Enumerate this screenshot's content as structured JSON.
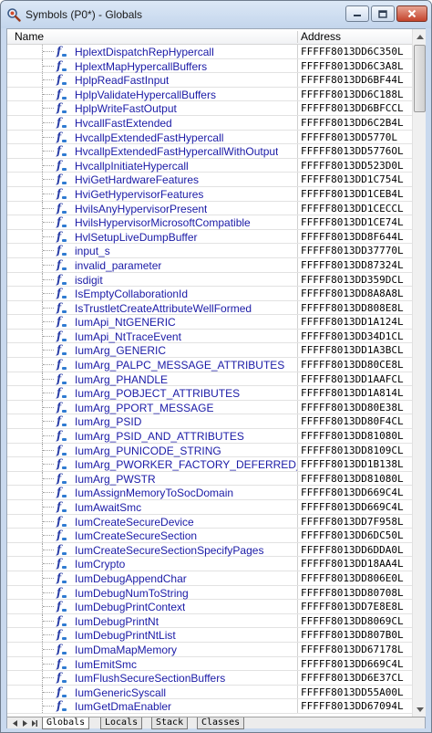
{
  "window": {
    "title": "Symbols (P0*) - Globals",
    "icon": "magnifier-icon"
  },
  "columns": {
    "name": "Name",
    "address": "Address"
  },
  "rows": [
    {
      "name": "HplextDispatchRepHypercall",
      "address": "FFFFF8013DD6C350L"
    },
    {
      "name": "HplextMapHypercallBuffers",
      "address": "FFFFF8013DD6C3A8L"
    },
    {
      "name": "HplpReadFastInput",
      "address": "FFFFF8013DD6BF44L"
    },
    {
      "name": "HplpValidateHypercallBuffers",
      "address": "FFFFF8013DD6C188L"
    },
    {
      "name": "HplpWriteFastOutput",
      "address": "FFFFF8013DD6BFCCL"
    },
    {
      "name": "HvcallFastExtended",
      "address": "FFFFF8013DD6C2B4L"
    },
    {
      "name": "HvcallpExtendedFastHypercall",
      "address": "FFFFF8013DD5770L"
    },
    {
      "name": "HvcallpExtendedFastHypercallWithOutput",
      "address": "FFFFF8013DD5776OL"
    },
    {
      "name": "HvcallpInitiateHypercall",
      "address": "FFFFF8013DD523D0L"
    },
    {
      "name": "HviGetHardwareFeatures",
      "address": "FFFFF8013DD1C754L"
    },
    {
      "name": "HviGetHypervisorFeatures",
      "address": "FFFFF8013DD1CEB4L"
    },
    {
      "name": "HvilsAnyHypervisorPresent",
      "address": "FFFFF8013DD1CECCL"
    },
    {
      "name": "HvilsHypervisorMicrosoftCompatible",
      "address": "FFFFF8013DD1CE74L"
    },
    {
      "name": "HvlSetupLiveDumpBuffer",
      "address": "FFFFF8013DD8F644L"
    },
    {
      "name": "input_s",
      "address": "FFFFF8013DD37770L"
    },
    {
      "name": "invalid_parameter",
      "address": "FFFFF8013DD87324L"
    },
    {
      "name": "isdigit",
      "address": "FFFFF8013DD359DCL"
    },
    {
      "name": "IsEmptyCollaborationId",
      "address": "FFFFF8013DD8A8A8L"
    },
    {
      "name": "IsTrustletCreateAttributeWellFormed",
      "address": "FFFFF8013DD808E8L"
    },
    {
      "name": "IumApi_NtGENERIC",
      "address": "FFFFF8013DD1A124L"
    },
    {
      "name": "IumApi_NtTraceEvent",
      "address": "FFFFF8013DD34D1CL"
    },
    {
      "name": "IumArg_GENERIC",
      "address": "FFFFF8013DD1A3BCL"
    },
    {
      "name": "IumArg_PALPC_MESSAGE_ATTRIBUTES",
      "address": "FFFFF8013DD80CE8L"
    },
    {
      "name": "IumArg_PHANDLE",
      "address": "FFFFF8013DD1AAFCL"
    },
    {
      "name": "IumArg_POBJECT_ATTRIBUTES",
      "address": "FFFFF8013DD1A814L"
    },
    {
      "name": "IumArg_PPORT_MESSAGE",
      "address": "FFFFF8013DD80E38L"
    },
    {
      "name": "IumArg_PSID",
      "address": "FFFFF8013DD80F4CL"
    },
    {
      "name": "IumArg_PSID_AND_ATTRIBUTES",
      "address": "FFFFF8013DD81080L"
    },
    {
      "name": "IumArg_PUNICODE_STRING",
      "address": "FFFFF8013DD8109CL"
    },
    {
      "name": "IumArg_PWORKER_FACTORY_DEFERRED_WORK",
      "address": "FFFFF8013DD1B138L"
    },
    {
      "name": "IumArg_PWSTR",
      "address": "FFFFF8013DD81080L"
    },
    {
      "name": "IumAssignMemoryToSocDomain",
      "address": "FFFFF8013DD669C4L"
    },
    {
      "name": "IumAwaitSmc",
      "address": "FFFFF8013DD669C4L"
    },
    {
      "name": "IumCreateSecureDevice",
      "address": "FFFFF8013DD7F958L"
    },
    {
      "name": "IumCreateSecureSection",
      "address": "FFFFF8013DD6DC50L"
    },
    {
      "name": "IumCreateSecureSectionSpecifyPages",
      "address": "FFFFF8013DD6DDA0L"
    },
    {
      "name": "IumCrypto",
      "address": "FFFFF8013DD18AA4L"
    },
    {
      "name": "IumDebugAppendChar",
      "address": "FFFFF8013DD806E0L"
    },
    {
      "name": "IumDebugNumToString",
      "address": "FFFFF8013DD80708L"
    },
    {
      "name": "IumDebugPrintContext",
      "address": "FFFFF8013DD7E8E8L"
    },
    {
      "name": "IumDebugPrintNt",
      "address": "FFFFF8013DD8069CL"
    },
    {
      "name": "IumDebugPrintNtList",
      "address": "FFFFF8013DD807B0L"
    },
    {
      "name": "IumDmaMapMemory",
      "address": "FFFFF8013DD67178L"
    },
    {
      "name": "IumEmitSmc",
      "address": "FFFFF8013DD669C4L"
    },
    {
      "name": "IumFlushSecureSectionBuffers",
      "address": "FFFFF8013DD6E37CL"
    },
    {
      "name": "IumGenericSyscall",
      "address": "FFFFF8013DD55A00L"
    },
    {
      "name": "IumGetDmaEnabler",
      "address": "FFFFF8013DD67094L"
    }
  ],
  "tabs": [
    {
      "label": "Globals",
      "active": true
    },
    {
      "label": "Locals",
      "active": false
    },
    {
      "label": "Stack",
      "active": false
    },
    {
      "label": "Classes",
      "active": false
    }
  ],
  "scrollbar": {
    "position": 0.0
  },
  "colors": {
    "title_bg": "#c9d9ee",
    "symbol_text": "#1a1aa6",
    "close_button": "#c4432b"
  }
}
